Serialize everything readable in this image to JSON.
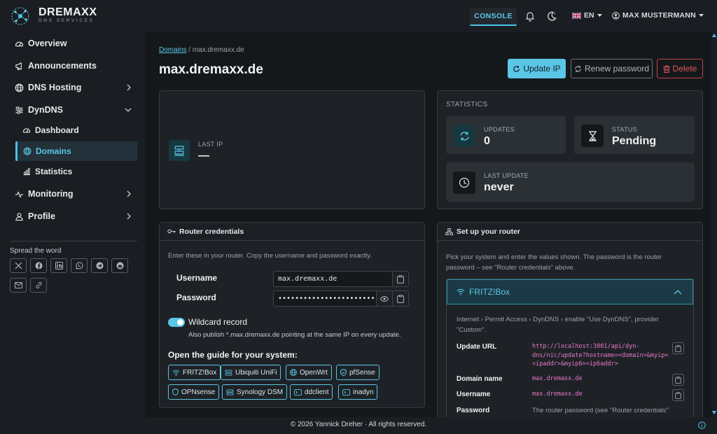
{
  "header": {
    "brand": "DREMAXX",
    "brand_sub": "DNS SERVICES",
    "console_label": "CONSOLE",
    "language": "EN",
    "user_name": "MAX MUSTERMANN"
  },
  "sidebar": {
    "items": [
      {
        "label": "Overview",
        "icon": "gauge-icon"
      },
      {
        "label": "Announcements",
        "icon": "megaphone-icon"
      },
      {
        "label": "DNS Hosting",
        "icon": "globe-icon"
      },
      {
        "label": "DynDNS",
        "icon": "sliders-icon"
      },
      {
        "label": "Monitoring",
        "icon": "pulse-icon"
      },
      {
        "label": "Profile",
        "icon": "person-icon"
      }
    ],
    "dyndns_sub": [
      {
        "label": "Dashboard",
        "icon": "gauge-icon"
      },
      {
        "label": "Domains",
        "icon": "globe-icon"
      },
      {
        "label": "Statistics",
        "icon": "bar-chart-icon"
      }
    ],
    "spread_label": "Spread the word",
    "share_icons": [
      "x-icon",
      "facebook-icon",
      "linkedin-icon",
      "whatsapp-icon",
      "telegram-icon",
      "reddit-icon",
      "email-icon",
      "link-icon"
    ]
  },
  "breadcrumb": {
    "root": "Domains",
    "sep": "/",
    "current": "max.dremaxx.de"
  },
  "page_title": "max.dremaxx.de",
  "actions": {
    "update": "Update IP",
    "renew": "Renew password",
    "delete": "Delete"
  },
  "last_ip": {
    "label": "LAST IP",
    "value": "—"
  },
  "statistics": {
    "title": "STATISTICS",
    "updates_label": "UPDATES",
    "updates_value": "0",
    "status_label": "STATUS",
    "status_value": "Pending",
    "last_update_label": "LAST UPDATE",
    "last_update_value": "never"
  },
  "credentials": {
    "title": "Router credentials",
    "hint": "Enter these in your router. Copy the username and password exactly.",
    "username_label": "Username",
    "username_value": "max.dremaxx.de",
    "password_label": "Password",
    "password_value": "••••••••••••••••••••••••••",
    "wildcard_label": "Wildcard record",
    "wildcard_hint": "Also publish *.max.dremaxx.de pointing at the same IP on every update.",
    "guide_title": "Open the guide for your system:",
    "guides": [
      "FRITZ!Box",
      "Ubiquiti UniFi",
      "OpenWrt",
      "pfSense",
      "OPNsense",
      "Synology DSM",
      "ddclient",
      "inadyn"
    ]
  },
  "setup": {
    "title": "Set up your router",
    "hint_1": "Pick your system and enter the values shown. The password is the router",
    "hint_2": "password – see \"Router credentials\" above.",
    "accordion_title": "FRITZ!Box",
    "path_1": "Internet › Permit Access › DynDNS › enable \"Use DynDNS\", provider",
    "path_2": "\"Custom\".",
    "update_url_label": "Update URL",
    "update_url_1": "http://localhost:3001/api/dyn-",
    "update_url_2": "dns/nic/update?hostname=<domain>&myip=",
    "update_url_3": "<ipaddr>&myip6=<ip6addr>",
    "domain_label": "Domain name",
    "domain_value": "max.dremaxx.de",
    "username_label": "Username",
    "username_value": "max.dremaxx.de",
    "password_label": "Password",
    "password_value": "The router password (see \"Router credentials\""
  },
  "footer": "© 2026 Yannick Dreher · All rights reserved."
}
